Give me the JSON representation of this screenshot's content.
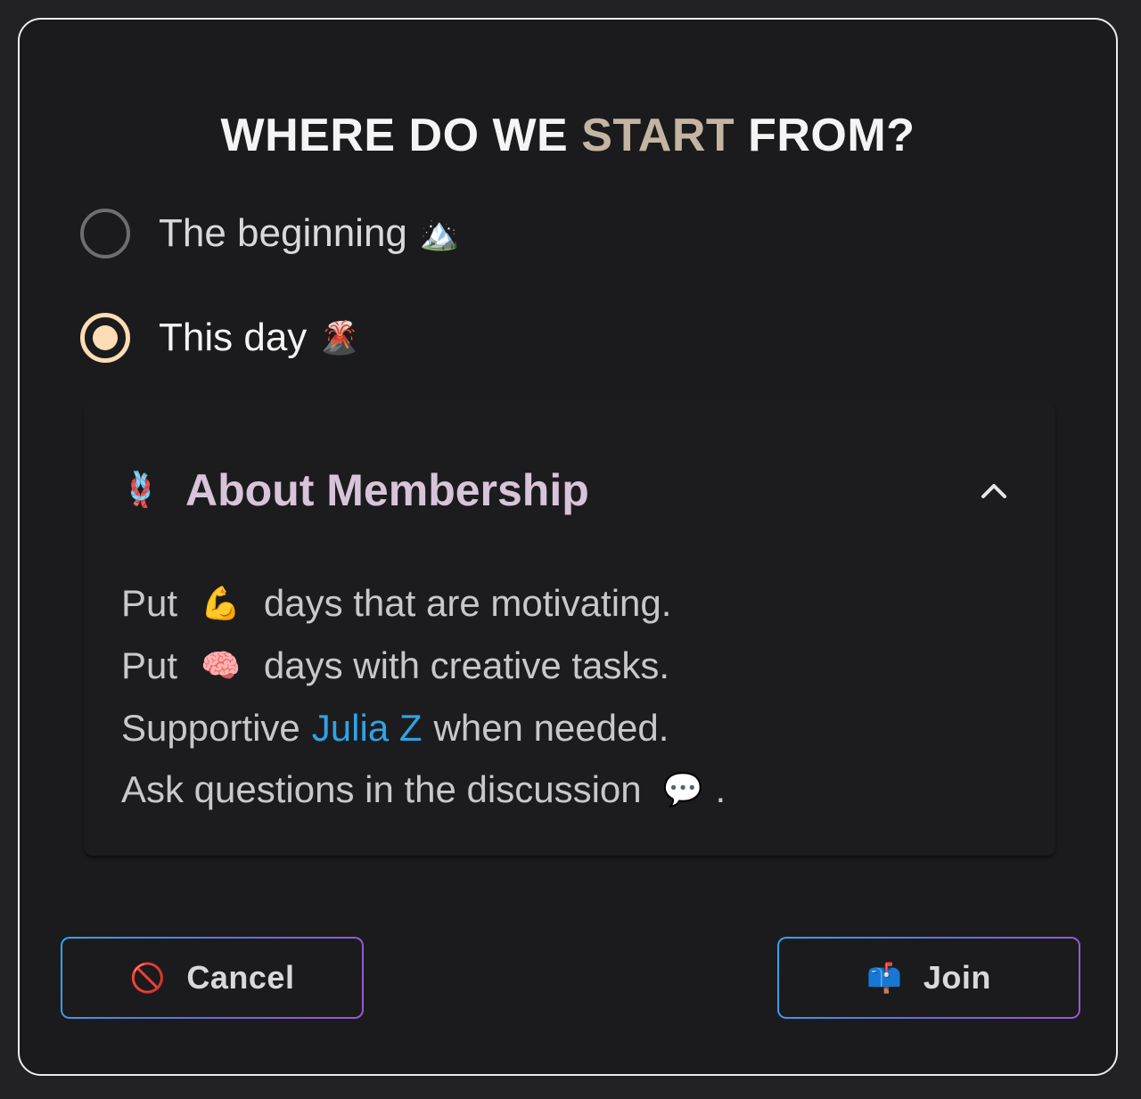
{
  "dialog": {
    "title_before": "WHERE DO WE ",
    "title_accent": "START",
    "title_after": " FROM?",
    "accent_color": "#c4b4a2"
  },
  "start_options": [
    {
      "label": "The beginning",
      "emoji": "🏔️",
      "checked": false
    },
    {
      "label": "This day",
      "emoji": "🌋",
      "checked": true
    }
  ],
  "membership": {
    "icon": "🪢",
    "title": "About Membership",
    "expanded": true,
    "lines": {
      "l1_before": "Put",
      "l1_emoji": "💪",
      "l1_after": "days that are motivating.",
      "l2_before": "Put",
      "l2_emoji": "🧠",
      "l2_after": "days with creative tasks.",
      "l3_before": "Supportive",
      "l3_link": "Julia Z",
      "l3_after": "when needed.",
      "l4_before": "Ask questions in the discussion",
      "l4_emoji": "💬",
      "l4_after": "."
    },
    "link_color": "#2fa3e6"
  },
  "buttons": {
    "cancel_icon": "🚫",
    "cancel_label": "Cancel",
    "join_icon": "📫",
    "join_label": "Join"
  }
}
